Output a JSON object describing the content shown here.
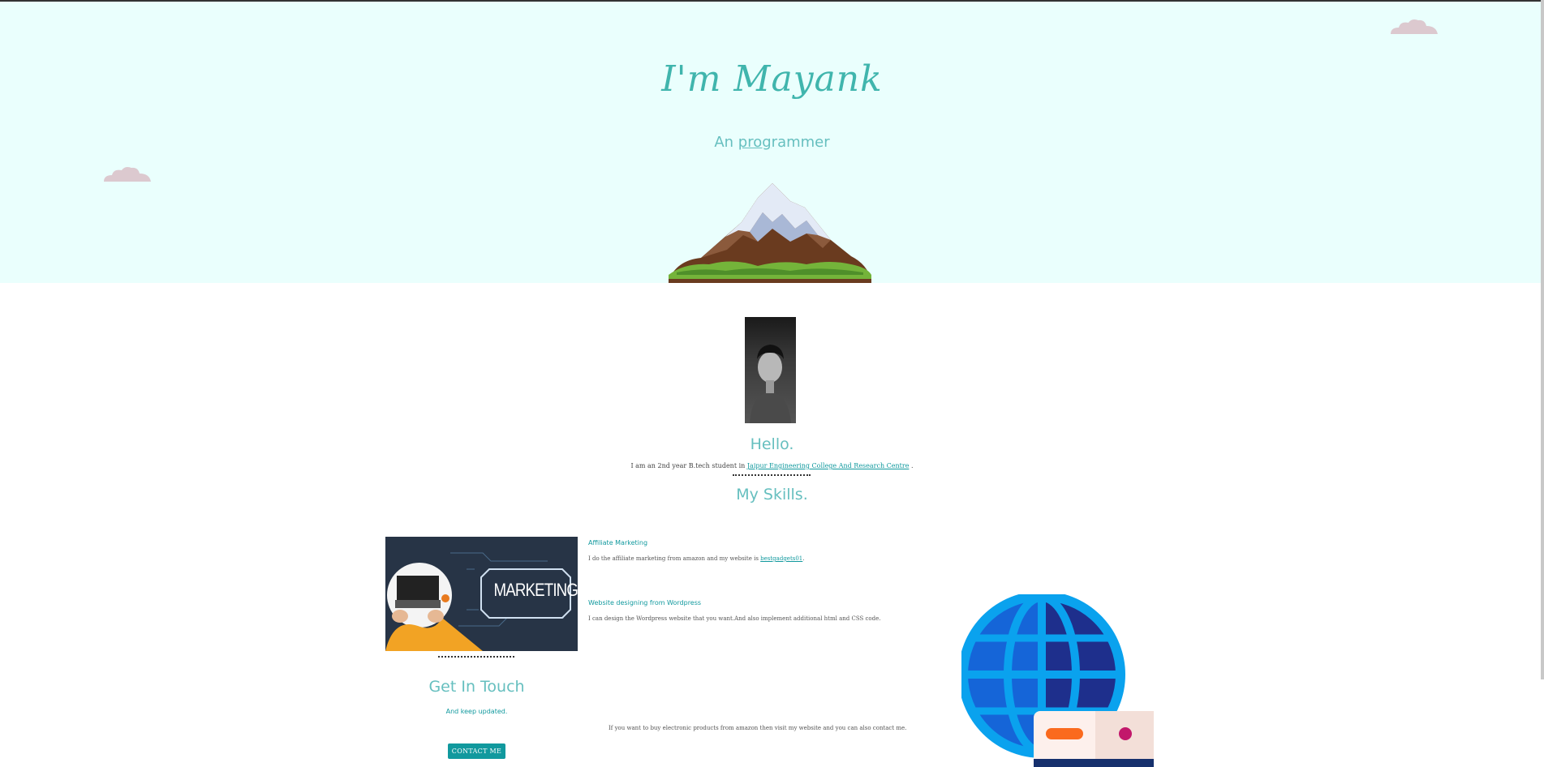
{
  "hero": {
    "title": "I'm Mayank",
    "subtitle_prefix": "An ",
    "subtitle_underlined": "prog",
    "subtitle_suffix": "rammer"
  },
  "about": {
    "heading": "Hello.",
    "intro_text": "I am an 2nd year B.tech student in ",
    "college_link": "Jaipur Engineering College And Research Centre",
    "intro_end": " ."
  },
  "skills": {
    "heading": "My Skills.",
    "image_text": "MARKETING",
    "items": [
      {
        "title": "Affiliate Marketing",
        "desc": "I do the affiliate marketing from amazon and my website is ",
        "link": "bestgadgets01",
        "desc_end": "."
      },
      {
        "title": "Website designing from Wordpress",
        "desc": "I can design the Wordpress website that you want.And also implement additional html and CSS code."
      }
    ]
  },
  "contact": {
    "heading": "Get In Touch",
    "tagline": "And keep updated.",
    "note": "If you want to buy electronic products from amazon then visit my website and you can also contact me.",
    "button_label": "CONTACT ME"
  },
  "colors": {
    "hero_bg": "#eafffd",
    "accent": "#66bfbf",
    "link": "#11999e",
    "cloud": "#dcc9cf"
  }
}
